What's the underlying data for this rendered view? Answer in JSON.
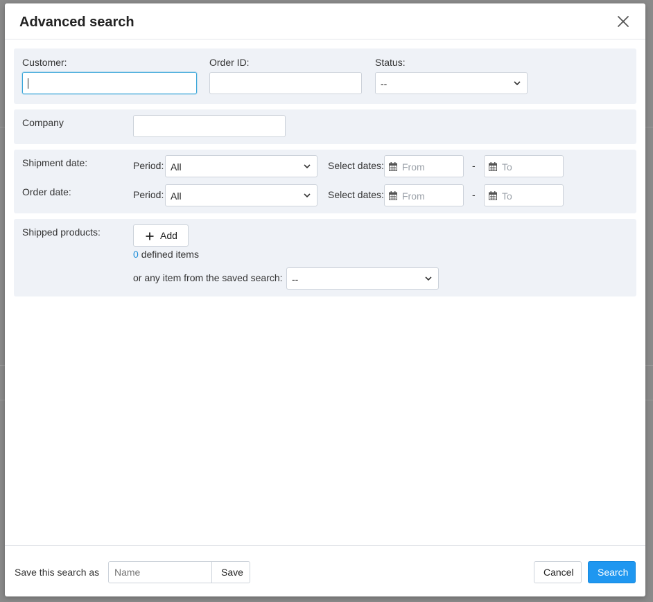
{
  "dialog": {
    "title": "Advanced search"
  },
  "filters": {
    "customer_label": "Customer:",
    "customer_value": "",
    "order_id_label": "Order ID:",
    "order_id_value": "",
    "status_label": "Status:",
    "status_value": "--",
    "company_label": "Company",
    "company_value": ""
  },
  "dates": {
    "shipment_label": "Shipment date:",
    "order_label": "Order date:",
    "period_label": "Period:",
    "period_value": "All",
    "select_dates_label": "Select dates:",
    "from_placeholder": "From",
    "to_placeholder": "To",
    "separator": "-"
  },
  "products": {
    "label": "Shipped products:",
    "add_label": "Add",
    "count": "0",
    "count_suffix": "defined items",
    "saved_search_label": "or any item from the saved search:",
    "saved_search_value": "--"
  },
  "footer": {
    "save_as_label": "Save this search as",
    "name_placeholder": "Name",
    "save_label": "Save",
    "cancel_label": "Cancel",
    "search_label": "Search"
  },
  "colors": {
    "accent": "#1f97f0",
    "panel_bg": "#eff2f7",
    "focus_border": "#3aa6d9"
  }
}
